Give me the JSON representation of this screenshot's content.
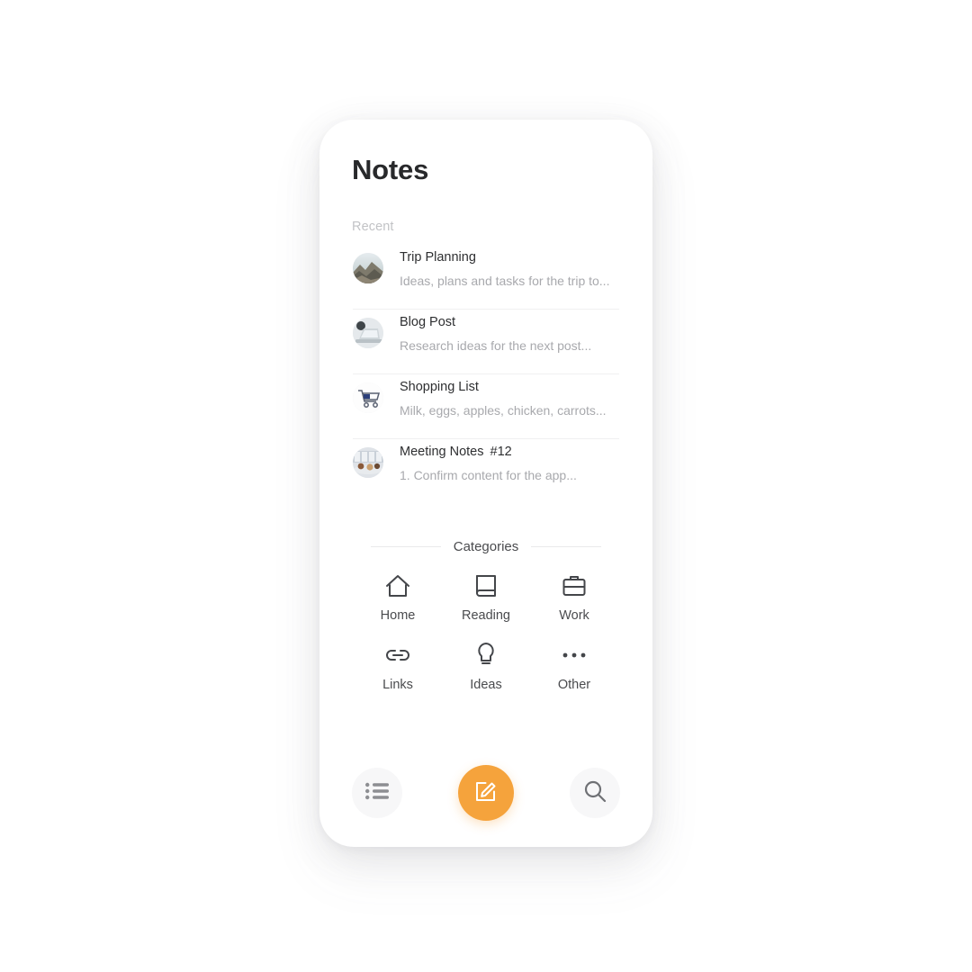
{
  "app": {
    "title": "Notes",
    "accent_color": "#f5a33c",
    "card_background": "#ffffff",
    "page_background": "#ffffff"
  },
  "recent": {
    "label": "Recent",
    "items": [
      {
        "title": "Trip Planning",
        "badge": "",
        "snippet": "Ideas, plans and tasks for the trip to...",
        "thumbnail": "mountain-landscape-photo"
      },
      {
        "title": "Blog Post",
        "badge": "",
        "snippet": "Research ideas for the next post...",
        "thumbnail": "laptop-photo"
      },
      {
        "title": "Shopping List",
        "badge": "",
        "snippet": "Milk, eggs, apples, chicken, carrots...",
        "thumbnail": "shopping-cart-photo"
      },
      {
        "title": "Meeting Notes",
        "badge": "#12",
        "snippet": "1. Confirm content for the app...",
        "thumbnail": "meeting-room-photo"
      }
    ]
  },
  "categories": {
    "title": "Categories",
    "items": [
      {
        "label": "Home",
        "icon": "home-icon"
      },
      {
        "label": "Reading",
        "icon": "book-icon"
      },
      {
        "label": "Work",
        "icon": "briefcase-icon"
      },
      {
        "label": "Links",
        "icon": "link-icon"
      },
      {
        "label": "Ideas",
        "icon": "lightbulb-icon"
      },
      {
        "label": "Other",
        "icon": "ellipsis-icon"
      }
    ]
  },
  "bottom_bar": {
    "list_button": {
      "icon": "list-icon"
    },
    "compose_button": {
      "icon": "compose-icon"
    },
    "search_button": {
      "icon": "search-icon"
    }
  }
}
